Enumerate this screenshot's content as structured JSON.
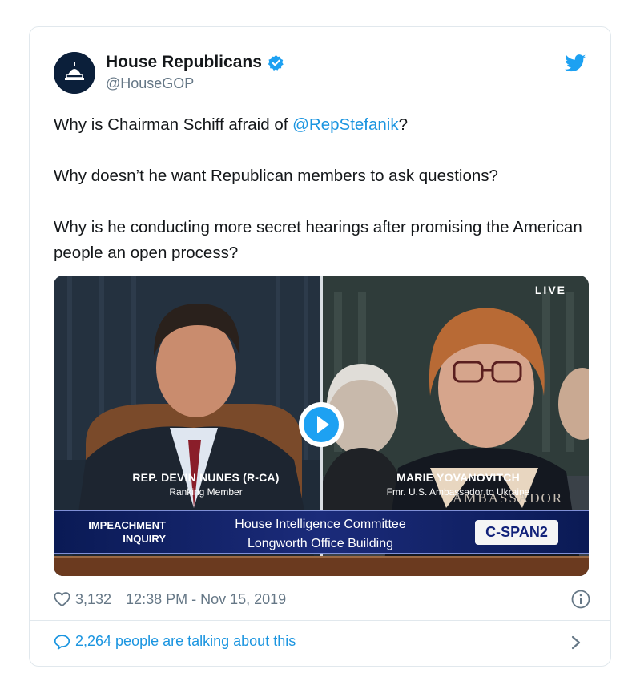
{
  "author": {
    "name": "House Republicans",
    "handle": "@HouseGOP"
  },
  "tweet": {
    "line1_prefix": "Why is Chairman Schiff afraid of ",
    "line1_mention": "@RepStefanik",
    "line1_suffix": "?",
    "line2": "Why doesn’t he want Republican members to ask questions?",
    "line3": "Why is he conducting more secret hearings after promising the American people an open process?"
  },
  "video": {
    "live_label": "LIVE",
    "left_caption_name": "REP. DEVIN NUNES (R-CA)",
    "left_caption_role": "Ranking Member",
    "right_caption_name": "MARIE YOVANOVITCH",
    "right_caption_role": "Fmr. U.S. Ambassador to Ukraine",
    "nameplate": "AMBASSADOR",
    "banner_left": "IMPEACHMENT INQUIRY",
    "banner_line1": "House Intelligence Committee",
    "banner_line2": "Longworth Office Building",
    "network": "C-SPAN2"
  },
  "meta": {
    "likes": "3,132",
    "timestamp": "12:38 PM - Nov 15, 2019"
  },
  "footer": {
    "talking": "2,264 people are talking about this"
  },
  "colors": {
    "link": "#1b95e0",
    "twitter_blue": "#1da1f2",
    "secondary_text": "#657786"
  },
  "icons": [
    "capitol-logo",
    "verified-badge-icon",
    "twitter-bird-icon",
    "play-icon",
    "heart-icon",
    "info-icon",
    "reply-bubble-icon",
    "chevron-right-icon"
  ]
}
